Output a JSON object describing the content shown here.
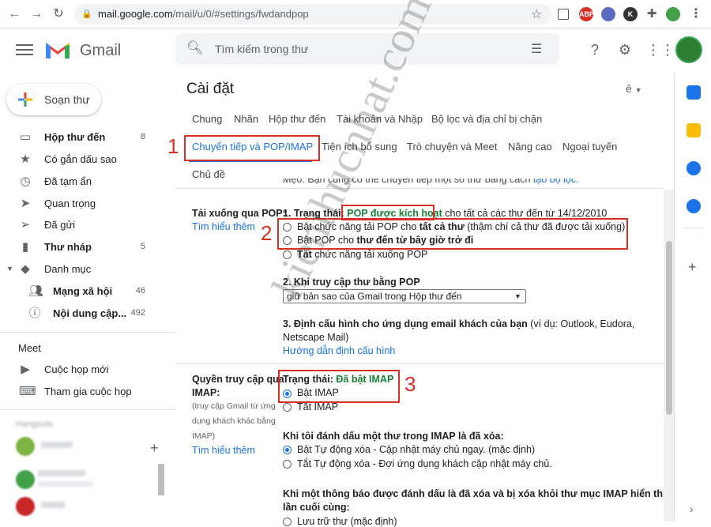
{
  "browser": {
    "url_host": "mail.google.com",
    "url_path": "/mail/u/0/#settings/fwdandpop"
  },
  "header": {
    "app_name": "Gmail",
    "search_placeholder": "Tìm kiếm trong thư"
  },
  "sidebar": {
    "compose_label": "Soạn thư",
    "items": [
      {
        "label": "Hộp thư đến",
        "count": "8",
        "icon": "inbox-icon"
      },
      {
        "label": "Có gắn dấu sao",
        "count": "",
        "icon": "star-icon"
      },
      {
        "label": "Đã tạm ẩn",
        "count": "",
        "icon": "clock-icon"
      },
      {
        "label": "Quan trọng",
        "count": "",
        "icon": "label-important-icon"
      },
      {
        "label": "Đã gửi",
        "count": "",
        "icon": "send-icon"
      },
      {
        "label": "Thư nháp",
        "count": "5",
        "icon": "draft-icon"
      },
      {
        "label": "Danh mục",
        "count": "",
        "icon": "category-icon"
      },
      {
        "label": "Mạng xã hội",
        "count": "46",
        "icon": "people-icon"
      },
      {
        "label": "Nội dung cập...",
        "count": "492",
        "icon": "info-icon"
      }
    ],
    "meet_title": "Meet",
    "meet_items": [
      {
        "label": "Cuộc họp mới",
        "icon": "video-icon"
      },
      {
        "label": "Tham gia cuộc họp",
        "icon": "keyboard-icon"
      }
    ],
    "hangouts_title": "Hangouts"
  },
  "settings": {
    "title": "Cài đặt",
    "lang_toggle": "ê",
    "tabs_row1": [
      "Chung",
      "Nhãn",
      "Hộp thư đến",
      "Tài khoản và Nhập",
      "Bộ lọc và địa chỉ bị chặn"
    ],
    "tabs_row2": [
      "Chuyển tiếp và POP/IMAP",
      "Tiện ích bổ sung",
      "Trò chuyện và Meet",
      "Nâng cao",
      "Ngoại tuyến"
    ],
    "tabs_row3": [
      "Chủ đề"
    ],
    "cut_off_text": "Mẹo: Bạn cũng có thể chuyển tiếp một số thư bằng cách ",
    "cut_off_link": "tạo bộ lọc.",
    "pop": {
      "label": "Tải xuống qua POP:",
      "learn_more": "Tìm hiểu thêm",
      "status_prefix": "1. Trạng thái: ",
      "status_value": "POP được kích hoạt",
      "status_suffix": " cho tất cả các thư đến từ 14/12/2010",
      "opt1_a": "Bật chức năng tải POP cho ",
      "opt1_b": "tất cả thư",
      "opt1_c": " (thậm chí cả thư đã được tải xuống)",
      "opt2_a": "Bật POP cho ",
      "opt2_b": "thư đến từ bây giờ trở đi",
      "opt3_a": "Tắt",
      "opt3_b": " chức năng tải xuống POP",
      "q2_title": "2. Khi truy cập thư bằng POP",
      "q2_select": "giữ bản sao của Gmail trong Hộp thư đến",
      "q3_title": "3. Định cấu hình cho ứng dụng email khách của bạn",
      "q3_hint": " (ví dụ: Outlook, Eudora,",
      "q3_hint2": "Netscape Mail)",
      "q3_link": "Hướng dẫn định cấu hình"
    },
    "imap": {
      "label_line1": "Quyền truy cập qua",
      "label_line2": "IMAP:",
      "sub1": "(truy cập Gmail từ ứng",
      "sub2": "dụng khách khác bằng",
      "sub3": "IMAP)",
      "learn_more": "Tìm hiểu thêm",
      "status_prefix": "Trạng thái: ",
      "status_value": "Đã bật IMAP",
      "opt_on": "Bật IMAP",
      "opt_off": "Tắt IMAP",
      "delete_title": "Khi tôi đánh dấu một thư trong IMAP là đã xóa:",
      "delete_opt1": "Bật Tự động xóa - Cập nhật máy chủ ngay. (mặc định)",
      "delete_opt2": "Tắt Tự động xóa - Đợi ứng dụng khách cập nhật máy chủ.",
      "expunge_title": "Khi một thông báo được đánh dấu là đã xóa và bị xóa khỏi thư mục IMAP hiển thị",
      "expunge_title2": "lần cuối cùng:",
      "expunge_opt1": "Lưu trữ thư (mặc định)"
    }
  },
  "annotations": [
    "1",
    "2",
    "3"
  ],
  "watermark": "kienthucnhat.com",
  "colors": {
    "accent_blue": "#1a73e8",
    "status_green": "#188038",
    "annotation_red": "#d93025"
  }
}
